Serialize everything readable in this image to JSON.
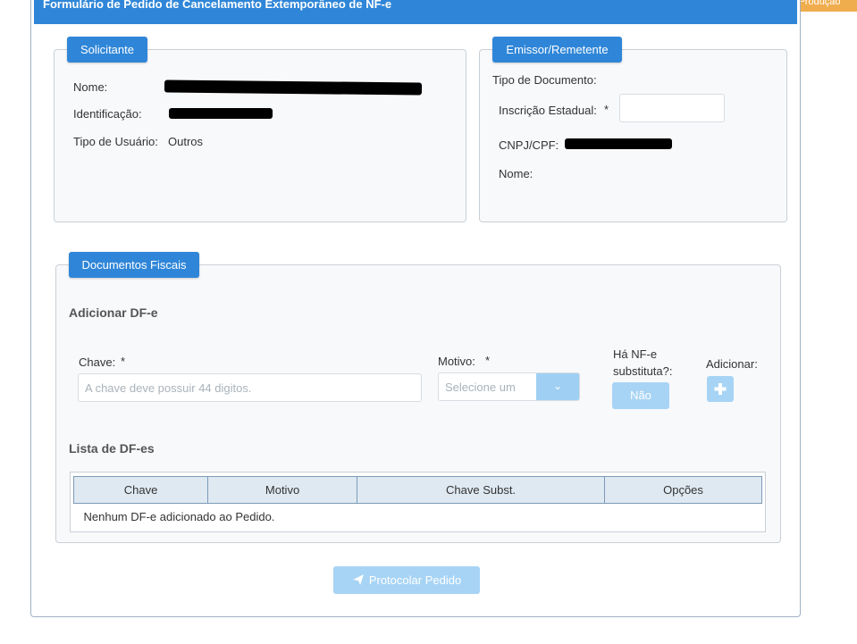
{
  "environment_badge": "Produção",
  "page_title": "Formulário de Pedido de Cancelamento Extemporâneo de NF-e",
  "solicitante": {
    "legend": "Solicitante",
    "nome_label": "Nome:",
    "identificacao_label": "Identificação:",
    "tipo_usuario_label": "Tipo de Usuário:",
    "tipo_usuario_value": "Outros"
  },
  "emissor": {
    "legend": "Emissor/Remetente",
    "tipo_documento_label": "Tipo de Documento:",
    "inscricao_label": "Inscrição Estadual:",
    "inscricao_required": "*",
    "inscricao_value": "",
    "cnpj_label": "CNPJ/CPF:",
    "nome_label": "Nome:"
  },
  "documentos": {
    "legend": "Documentos Fiscais",
    "adicionar_title": "Adicionar DF-e",
    "chave_label": "Chave:",
    "chave_required": "*",
    "chave_placeholder": "A chave deve possuir 44 digitos.",
    "motivo_label": "Motivo:",
    "motivo_required": "*",
    "motivo_selected": "Selecione um",
    "substituta_label_line1": "Há NF-e",
    "substituta_label_line2": "substituta?:",
    "substituta_button": "Não",
    "adicionar_label": "Adicionar:",
    "adicionar_button_icon": "plus-icon",
    "lista_title": "Lista de DF-es",
    "table": {
      "headers": [
        "Chave",
        "Motivo",
        "Chave Subst.",
        "Opções"
      ],
      "empty_message": "Nenhum DF-e adicionado ao Pedido."
    }
  },
  "submit": {
    "label": "Protocolar Pedido",
    "icon": "paper-plane-icon"
  },
  "colors": {
    "primary": "#2f86d8",
    "button_disabled": "#a7d4f5",
    "badge": "#f0ad4e"
  }
}
